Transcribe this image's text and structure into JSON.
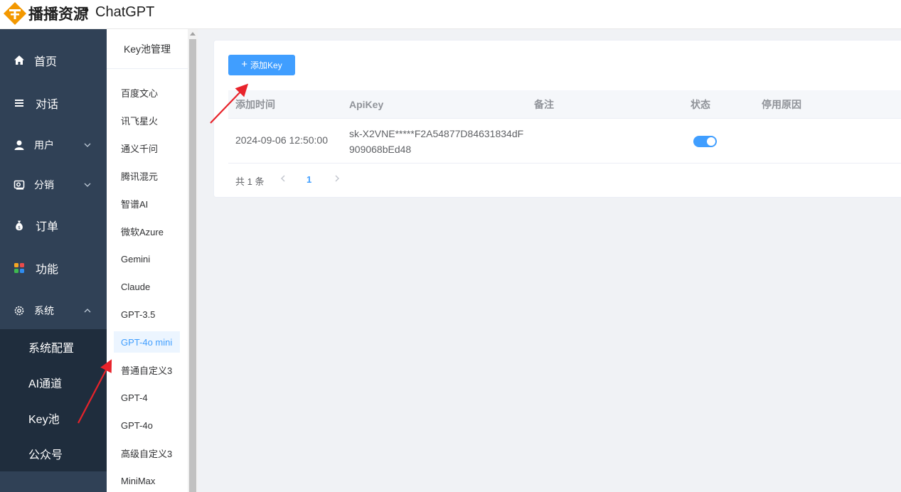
{
  "header": {
    "brand": "播播资源",
    "dot": "•",
    "product": "ChatGPT"
  },
  "sidebar": {
    "items": [
      {
        "label": "首页",
        "icon": "home-icon"
      },
      {
        "label": "对话",
        "icon": "list-icon"
      },
      {
        "label": "用户",
        "icon": "user-icon"
      },
      {
        "label": "分销",
        "icon": "distribution-icon"
      },
      {
        "label": "订单",
        "icon": "money-bag-icon"
      },
      {
        "label": "功能",
        "icon": "grid-icon"
      },
      {
        "label": "系统",
        "icon": "gear-icon"
      }
    ],
    "submenu": [
      "系统配置",
      "AI通道",
      "Key池",
      "公众号"
    ]
  },
  "panel": {
    "title": "Key池管理",
    "items": [
      "百度文心",
      "讯飞星火",
      "通义千问",
      "腾讯混元",
      "智谱AI",
      "微软Azure",
      "Gemini",
      "Claude",
      "GPT-3.5",
      "GPT-4o mini",
      "普通自定义3",
      "GPT-4",
      "GPT-4o",
      "高级自定义3",
      "MiniMax"
    ],
    "active": "GPT-4o mini"
  },
  "toolbar": {
    "add_label": "添加Key",
    "add_icon": "plus-icon"
  },
  "table": {
    "columns": [
      "添加时间",
      "ApiKey",
      "备注",
      "状态",
      "停用原因"
    ],
    "rows": [
      {
        "time": "2024-09-06 12:50:00",
        "apikey": "sk-X2VNE*****F2A54877D84631834dF909068bEd48",
        "remark": "",
        "status_on": true,
        "reason": ""
      }
    ]
  },
  "pagination": {
    "total": "共 1 条",
    "current": "1",
    "prev_icon": "chevron-left-icon",
    "next_icon": "chevron-right-icon"
  },
  "colors": {
    "sidebar_bg": "#304156",
    "submenu_bg": "#1f2d3d",
    "primary": "#409eff",
    "annotation_arrow": "#e8232b",
    "logo_orange": "#f39800"
  }
}
